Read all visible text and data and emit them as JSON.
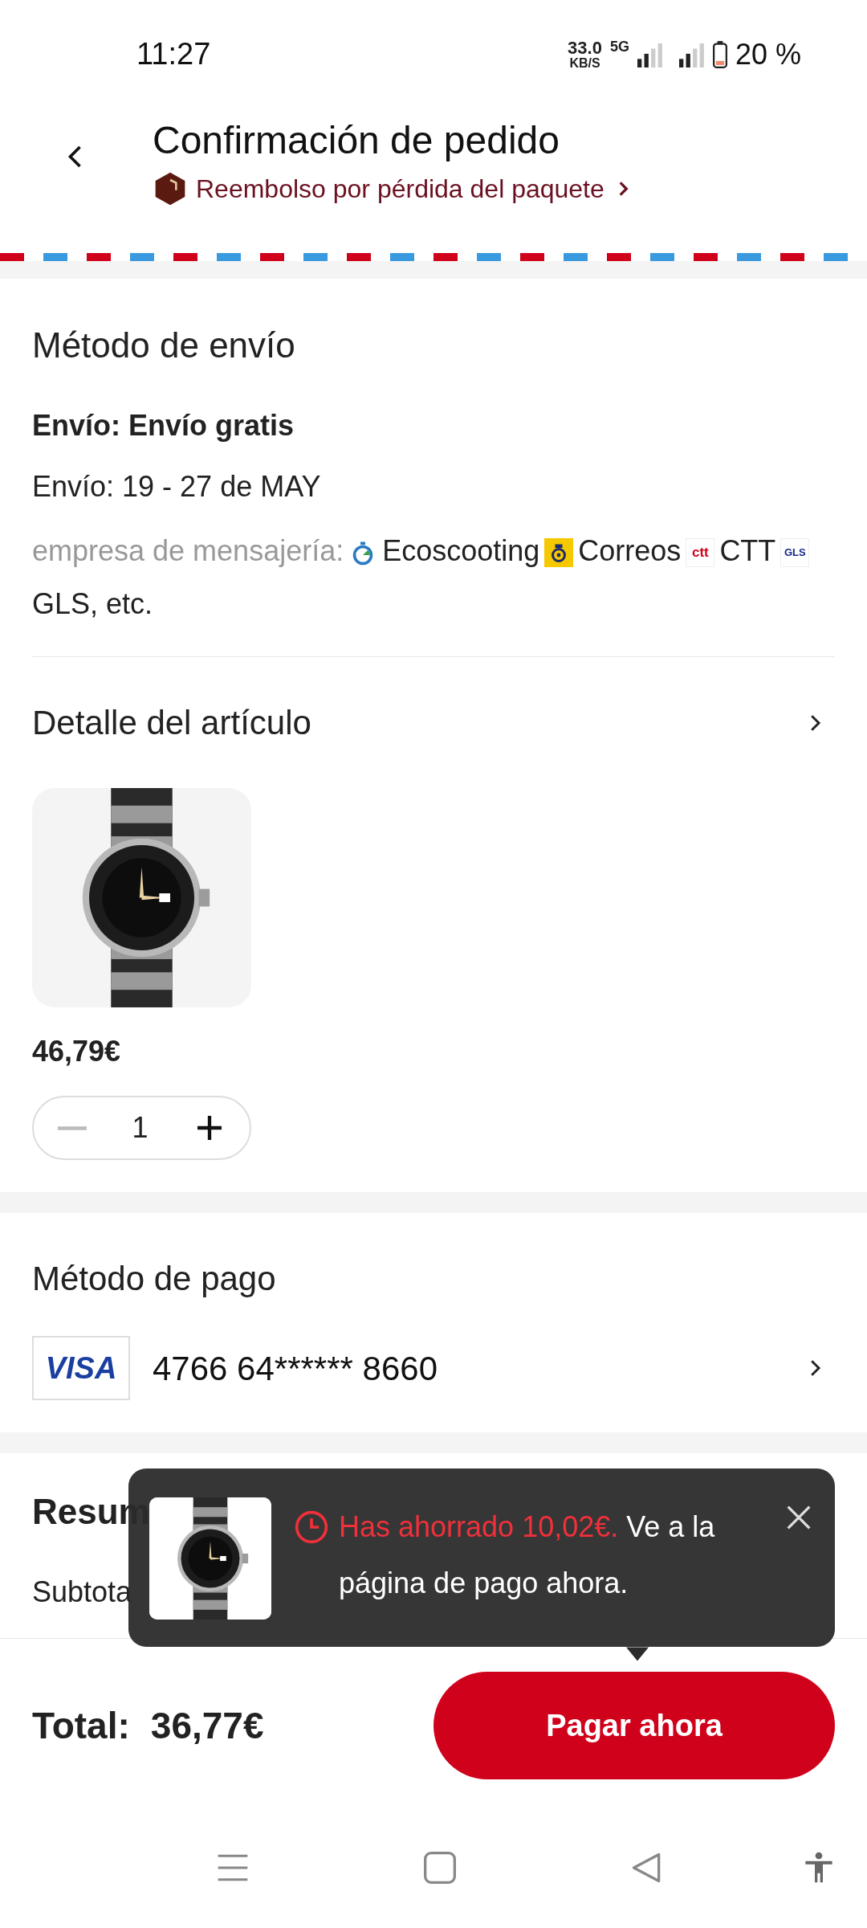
{
  "status_bar": {
    "time": "11:27",
    "speed": "33.0",
    "speed_unit": "KB/S",
    "network": "5G",
    "battery": "20 %"
  },
  "header": {
    "title": "Confirmación de pedido",
    "subtitle": "Reembolso por pérdida del paquete"
  },
  "shipping": {
    "title": "Método de envío",
    "method": "Envío: Envío gratis",
    "delivery": "Envío: 19 - 27 de MAY",
    "carriers_label": "empresa de mensajería:",
    "carriers": [
      {
        "kind": "stopwatch",
        "name": "Ecoscooting"
      },
      {
        "kind": "horn",
        "name": "Correos"
      },
      {
        "kind": "text",
        "logo": "ctt",
        "name": "CTT"
      },
      {
        "kind": "text",
        "logo": "GLS",
        "name": "GLS, etc."
      }
    ]
  },
  "item": {
    "title": "Detalle del artículo",
    "price": "46,79€",
    "quantity": "1"
  },
  "payment": {
    "title": "Método de pago",
    "card_brand": "VISA",
    "card_number": "4766 64****** 8660"
  },
  "summary": {
    "title": "Resum",
    "rows": [
      {
        "label": "Subtota"
      }
    ]
  },
  "toast": {
    "highlight": "Has ahorrado 10,02€.",
    "text": "Ve a la página de pago ahora."
  },
  "footer": {
    "label": "Total:",
    "amount": "36,77€",
    "button": "Pagar ahora"
  }
}
